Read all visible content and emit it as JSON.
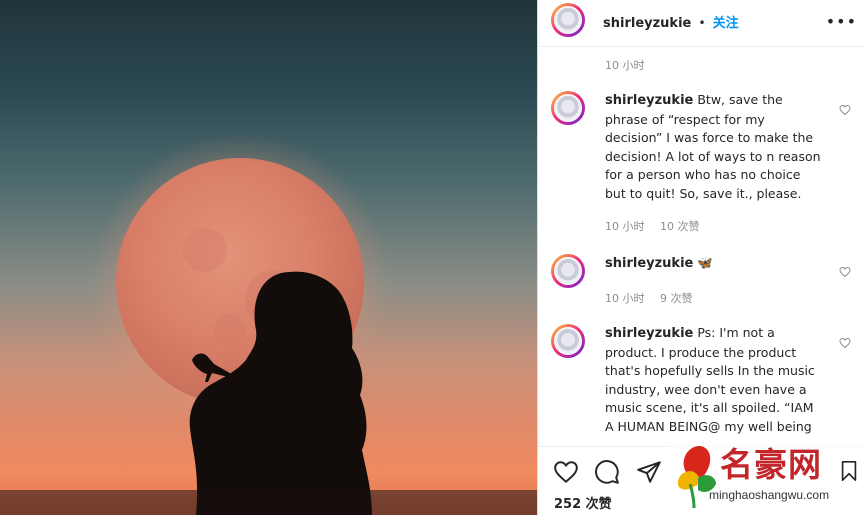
{
  "post": {
    "username": "shirleyzukie",
    "separator": "•",
    "follow_label": "关注",
    "more_label": "•••",
    "first_time": "10 小时",
    "likes": "252 次赞"
  },
  "comments": [
    {
      "username": "shirleyzukie",
      "text": "Btw, save the phrase of “respect for my decision” I was force to make the decision! A lot of ways to n reason for a person who has no choice but to quit! So, save it., please.",
      "time": "10 小时",
      "likes": "10 次赞"
    },
    {
      "username": "shirleyzukie",
      "text": "🦋",
      "time": "10 小时",
      "likes": "9 次赞"
    },
    {
      "username": "shirleyzukie",
      "text": "Ps: I'm not a product. I produce the product that's hopefully sells In the music industry, wee don't even have a music scene, it's all spoiled. “IAM A HUMAN BEING@ my well being"
    }
  ],
  "watermark": {
    "name": "名豪网",
    "url": "minghaoshangwu.com"
  },
  "icons": [
    "heart-icon",
    "comment-icon",
    "share-icon",
    "bookmark-icon",
    "more-icon",
    "avatar"
  ]
}
